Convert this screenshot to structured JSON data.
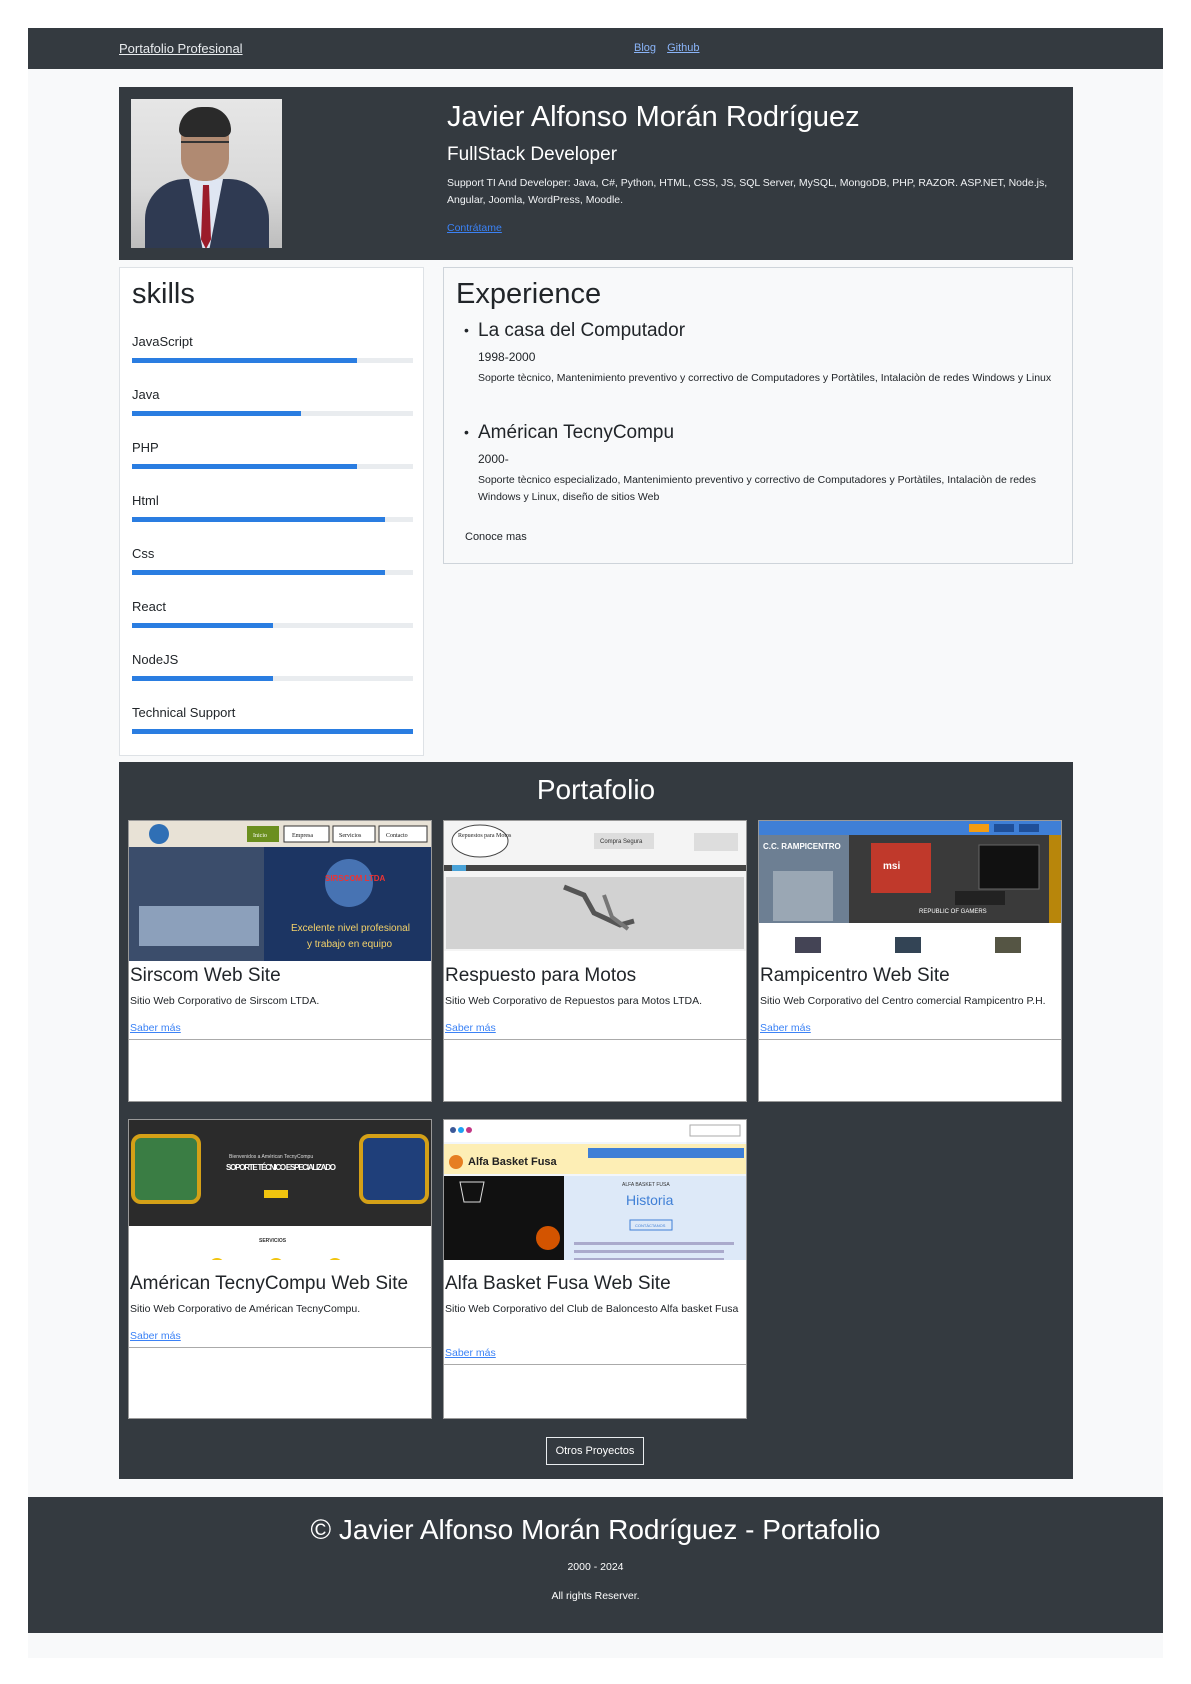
{
  "nav": {
    "brand": "Portafolio Profesional",
    "links": [
      "Blog",
      "Github"
    ]
  },
  "hero": {
    "name": "Javier Alfonso Morán Rodríguez",
    "role": "FullStack Developer",
    "description": "Support TI And Developer: Java, C#, Python, HTML, CSS, JS, SQL Server, MySQL, MongoDB, PHP, RAZOR. ASP.NET, Node.js, Angular, Joomla, WordPress, Moodle.",
    "link": "Contrátame"
  },
  "skills": {
    "title": "skills",
    "accent": "#2a7de1",
    "items": [
      {
        "label": "JavaScript",
        "level": 0.8
      },
      {
        "label": "Java",
        "level": 0.6
      },
      {
        "label": "PHP",
        "level": 0.8
      },
      {
        "label": "Html",
        "level": 0.9
      },
      {
        "label": "Css",
        "level": 0.9
      },
      {
        "label": "React",
        "level": 0.5
      },
      {
        "label": "NodeJS",
        "level": 0.5
      },
      {
        "label": "Technical Support",
        "level": 1.0
      }
    ]
  },
  "experience": {
    "title": "Experience",
    "jobs": [
      {
        "company": "La casa del Computador",
        "years": "1998-2000",
        "description": "Soporte tècnico, Mantenimiento preventivo y correctivo de Computadores y Portàtiles, Intalaciòn de redes Windows y Linux"
      },
      {
        "company": "Américan TecnyCompu",
        "years": "2000-",
        "description": "Soporte tècnico especializado, Mantenimiento preventivo y correctivo de Computadores y Portàtiles, Intalaciòn de redes Windows y Linux, diseño de sitios Web"
      }
    ],
    "more": "Conoce mas"
  },
  "portfolio": {
    "title": "Portafolio",
    "cards": [
      {
        "title": "Sirscom Web Site",
        "description": "Sitio Web Corporativo de Sirscom LTDA.",
        "link": "Saber más",
        "thumb": "sirscom"
      },
      {
        "title": "Respuesto para Motos",
        "description": "Sitio Web Corporativo de Repuestos para Motos LTDA.",
        "link": "Saber más",
        "thumb": "motos"
      },
      {
        "title": "Rampicentro Web Site",
        "description": "Sitio Web Corporativo del Centro comercial Rampicentro P.H.",
        "link": "Saber más",
        "thumb": "rampicentro"
      },
      {
        "title": "Américan TecnyCompu Web Site",
        "description": "Sitio Web Corporativo de Américan TecnyCompu.",
        "link": "Saber más",
        "thumb": "tecnycompu"
      },
      {
        "title": "Alfa Basket Fusa Web Site",
        "description": "Sitio Web Corporativo del Club de Baloncesto Alfa basket Fusa",
        "link": "Saber más",
        "thumb": "alfabasket"
      }
    ],
    "thumb_text": {
      "sirscom": {
        "nav": [
          "Inicio",
          "Empresa",
          "Servicios",
          "Contacto"
        ],
        "brand": "SIRSCOM LTDA",
        "tagline_1": "Excelente nivel profesional",
        "tagline_2": "y trabajo en equipo"
      },
      "motos": {
        "brand": "Repuestos para Motos",
        "badge": "Compra Segura"
      },
      "rampicentro": {
        "brand": "C.C. RAMPICENTRO",
        "logo": "msi",
        "caption": "REPUBLIC OF GAMERS"
      },
      "tecnycompu": {
        "line_1": "Bienvenidos a Américan TecnyCompu",
        "headline": "SOPORTE TÉCNICO ESPECIALIZADO",
        "section": "SERVICIOS"
      },
      "alfabasket": {
        "brand": "Alfa Basket Fusa",
        "label": "ALFA BASKET FUSA",
        "heading": "Historia",
        "button": "CONTÁCTANOS"
      }
    },
    "other_button": "Otros Proyectos"
  },
  "footer": {
    "title": "© Javier Alfonso Morán Rodríguez - Portafolio",
    "years": "2000 - 2024",
    "rights": "All rights Reserver."
  }
}
